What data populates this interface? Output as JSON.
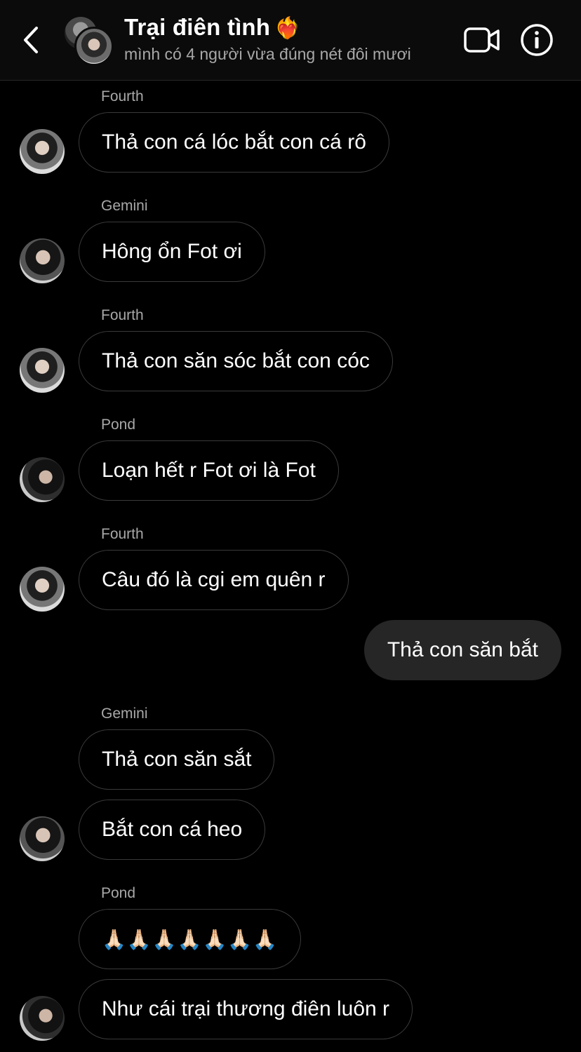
{
  "header": {
    "title": "Trại điên tình",
    "title_emoji": "❤️‍🔥",
    "subtitle": "mình có 4 người vừa đúng nét đôi mươi"
  },
  "messages": [
    {
      "sender": "Fourth",
      "text": "Thả con cá lóc bắt con cá rô"
    },
    {
      "sender": "Gemini",
      "text": "Hông ổn Fot ơi"
    },
    {
      "sender": "Fourth",
      "text": "Thả con săn sóc bắt con cóc"
    },
    {
      "sender": "Pond",
      "text": "Loạn hết r Fot ơi là Fot"
    },
    {
      "sender": "Fourth",
      "text": "Câu đó là cgi em quên r"
    },
    {
      "sender": "me",
      "text": "Thả con săn bắt"
    },
    {
      "sender": "Gemini",
      "text": "Thả con săn sắt"
    },
    {
      "sender": "Gemini",
      "text": "Bắt con cá heo"
    },
    {
      "sender": "Pond",
      "text": "🙏🏻🙏🏻🙏🏻🙏🏻🙏🏻🙏🏻🙏🏻"
    },
    {
      "sender": "Pond",
      "text": "Như cái trại thương điên luôn r"
    }
  ],
  "colors": {
    "background": "#000000",
    "outgoing_bubble": "#262626",
    "bubble_border": "#3a3a3a",
    "secondary_text": "#a8a8a8"
  }
}
